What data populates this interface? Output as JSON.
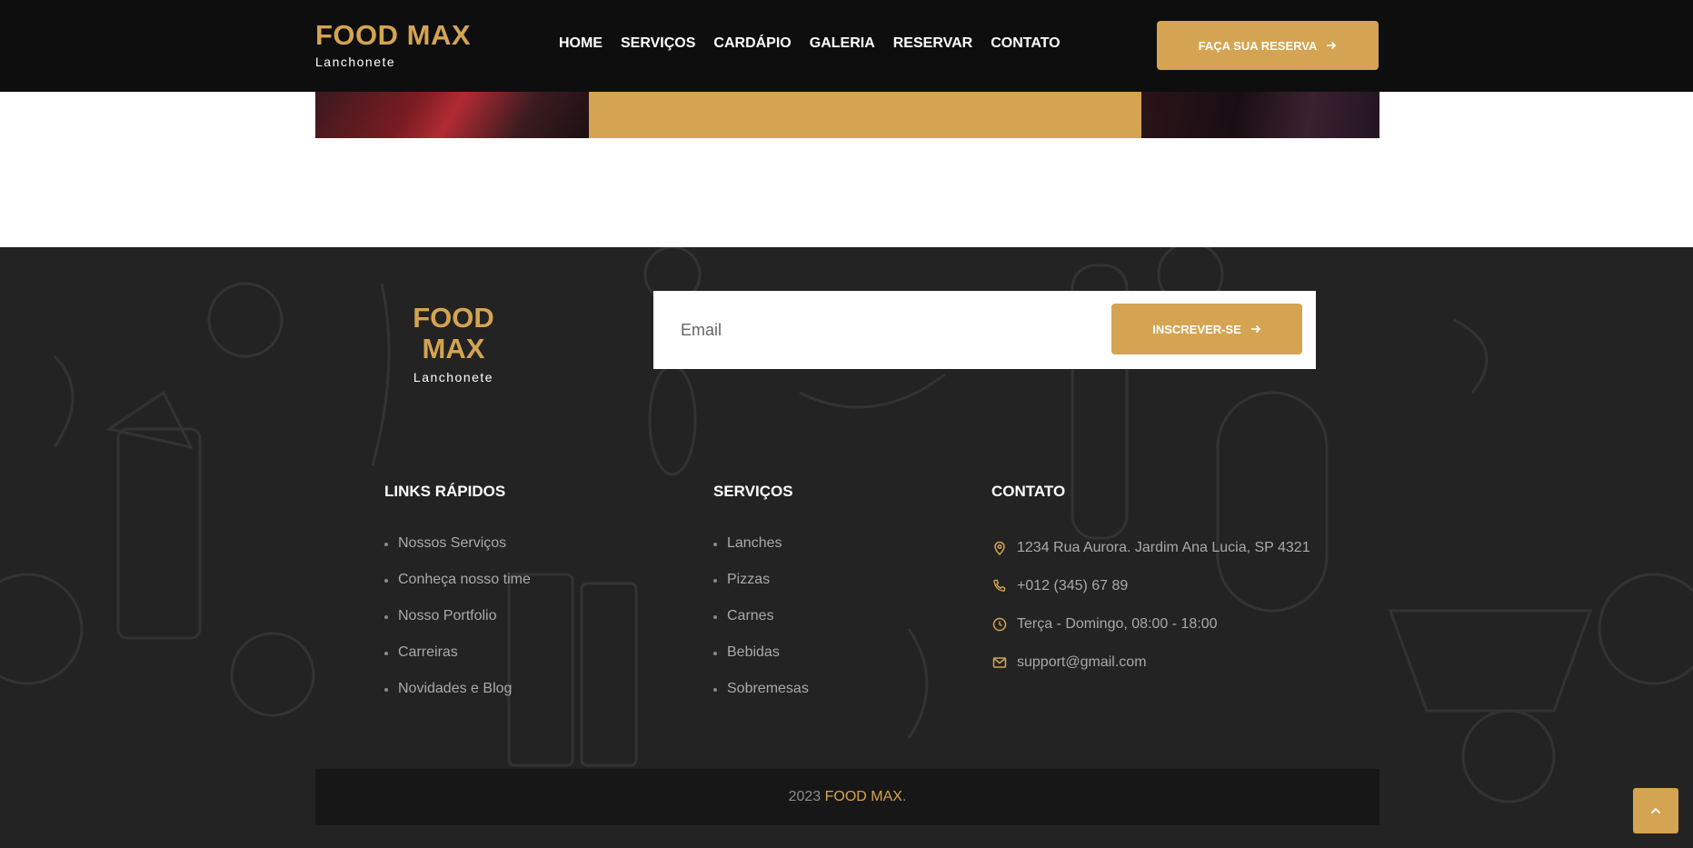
{
  "colors": {
    "accent": "#d4a452",
    "header_bg": "#0e0e0e",
    "footer_bg": "#232323",
    "copyright_bg": "#171717"
  },
  "header": {
    "brand": {
      "name": "FOOD MAX",
      "subtitle": "Lanchonete"
    },
    "nav": [
      "HOME",
      "SERVIÇOS",
      "CARDÁPIO",
      "GALERIA",
      "RESERVAR",
      "CONTATO"
    ],
    "cta_label": "FAÇA SUA RESERVA",
    "cta_icon": "arrow-right-icon"
  },
  "footer": {
    "brand": {
      "name": "FOOD MAX",
      "subtitle": "Lanchonete"
    },
    "newsletter": {
      "placeholder": "Email",
      "value": "",
      "button_label": "INSCREVER-SE",
      "button_icon": "arrow-right-icon"
    },
    "quick_links": {
      "title": "LINKS RÁPIDOS",
      "items": [
        "Nossos Serviços",
        "Conheça nosso time",
        "Nosso Portfolio",
        "Carreiras",
        "Novidades e Blog"
      ]
    },
    "services": {
      "title": "SERVIÇOS",
      "items": [
        "Lanches",
        "Pizzas",
        "Carnes",
        "Bebidas",
        "Sobremesas"
      ]
    },
    "contact": {
      "title": "CONTATO",
      "items": [
        {
          "icon": "map-pin-icon",
          "text": "1234 Rua Aurora. Jardim Ana Lucia, SP 4321"
        },
        {
          "icon": "phone-icon",
          "text": "+012 (345) 67 89"
        },
        {
          "icon": "clock-icon",
          "text": "Terça - Domingo, 08:00 - 18:00"
        },
        {
          "icon": "mail-icon",
          "text": "support@gmail.com"
        }
      ]
    },
    "copyright": {
      "year": "2023",
      "brand": "FOOD MAX",
      "suffix": "."
    }
  },
  "back_to_top_icon": "chevron-up-icon"
}
